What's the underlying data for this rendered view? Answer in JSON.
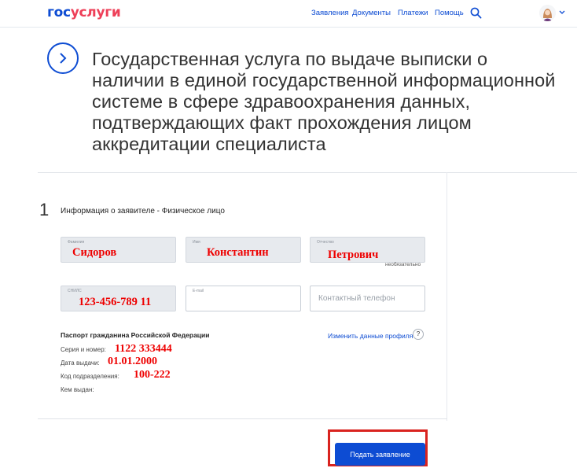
{
  "header": {
    "logo_part1": "гос",
    "logo_part2": "услуги",
    "nav": [
      "Заявления",
      "Документы",
      "Платежи",
      "Помощь"
    ]
  },
  "page": {
    "title": "Государственная услуга по выдаче выписки о наличии в единой государственной информационной системе в сфере здравоохранения данных, подтверждающих факт прохождения лицом аккредитации специалиста"
  },
  "step": {
    "number": "1",
    "title": "Информация о заявителе - Физическое лицо"
  },
  "fields": {
    "surname": {
      "label": "Фамилия",
      "value": "Сидоров"
    },
    "name": {
      "label": "Имя",
      "value": "Константин"
    },
    "patronymic": {
      "label": "Отчество",
      "value": "Петрович",
      "note": "необязательно"
    },
    "snils": {
      "label": "СНИЛС",
      "value": "123-456-789 11"
    },
    "email": {
      "label": "E-mail",
      "value": ""
    },
    "phone": {
      "placeholder": "Контактный телефон"
    }
  },
  "passport": {
    "title": "Паспорт гражданина Российской Федерации",
    "series_label": "Серия и номер:",
    "series_value": "1122 333444",
    "date_label": "Дата выдачи:",
    "date_value": "01.01.2000",
    "code_label": "Код подразделения:",
    "code_value": "100-222",
    "issuer_label": "Кем выдан:",
    "edit_link": "Изменить данные профиля",
    "help": "?"
  },
  "actions": {
    "submit": "Подать заявление"
  },
  "colors": {
    "brand_blue": "#0d4cd3",
    "brand_red": "#ee3f58",
    "annotation_red": "#e00000",
    "highlight_frame": "#d9231f"
  }
}
